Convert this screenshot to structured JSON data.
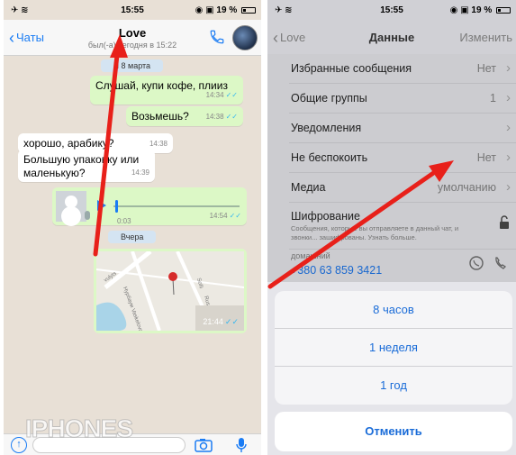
{
  "left_phone": {
    "status": {
      "time": "15:55",
      "battery": "19 %"
    },
    "nav": {
      "back_label": "Чаты",
      "title": "Love",
      "subtitle": "был(-а) сегодня в 15:22"
    },
    "messages": [
      {
        "type": "date",
        "text": "Ч 8 марта"
      },
      {
        "type": "out",
        "text": "Слушай, купи кофе, плииз",
        "time": "14:34"
      },
      {
        "type": "out",
        "text": "Возьмешь?",
        "time": "14:38"
      },
      {
        "type": "in",
        "text": "хорошо, арабику?",
        "time": "14:38"
      },
      {
        "type": "in",
        "text": "Большую упаковку или маленькую?",
        "time": "14:39"
      },
      {
        "type": "voice",
        "duration": "0:03",
        "time": "14:54"
      },
      {
        "type": "date",
        "text": "Вчера"
      },
      {
        "type": "location",
        "time": "21:44",
        "streets": [
          "Нурбаум Vaskelova vulyts",
          "Sofii",
          "Rus",
          "vulyts"
        ]
      }
    ],
    "watermark": "IPHONES"
  },
  "right_phone": {
    "status": {
      "time": "15:55",
      "battery": "19 %"
    },
    "nav": {
      "back_label": "Love",
      "title": "Данные",
      "edit_label": "Изменить"
    },
    "rows": [
      {
        "label": "Избранные сообщения",
        "value": "Нет"
      },
      {
        "label": "Общие группы",
        "value": "1"
      },
      {
        "label": "Уведомления",
        "value": ""
      },
      {
        "label": "Не беспокоить",
        "value": "Нет"
      },
      {
        "label": "Медиа",
        "value": "умолчанию"
      }
    ],
    "encryption": {
      "label": "Шифрование",
      "description": "Сообщения, которые вы отправляете в данный чат, и звонки... зашифрованы. Узнать больше."
    },
    "phone": {
      "label": "домашний",
      "number": "+380 63 859 3421"
    },
    "action_sheet": {
      "options": [
        "8 часов",
        "1 неделя",
        "1 год"
      ],
      "cancel": "Отменить"
    }
  },
  "colors": {
    "accent": "#1a7cf4",
    "outgoing_bubble": "#dcf8c6",
    "annotation_arrow": "#e8201a"
  }
}
